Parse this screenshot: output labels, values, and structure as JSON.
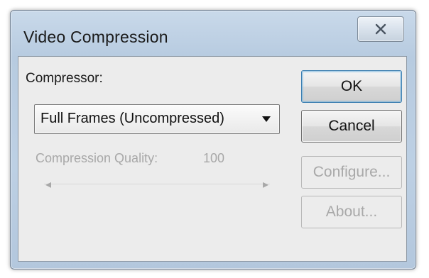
{
  "window": {
    "title": "Video Compression",
    "close_icon": "close-icon"
  },
  "form": {
    "compressor_label": "Compressor:",
    "compressor_selected": "Full Frames (Uncompressed)",
    "quality_label": "Compression Quality:",
    "quality_value": "100",
    "quality_slider_level_percent": 100
  },
  "buttons": {
    "ok": "OK",
    "cancel": "Cancel",
    "configure": "Configure...",
    "about": "About..."
  },
  "colors": {
    "title_bar": "#c9d9ea",
    "client_bg": "#ececec",
    "disabled_text": "#a8a8a8",
    "default_button_border": "#3c7fb1"
  }
}
